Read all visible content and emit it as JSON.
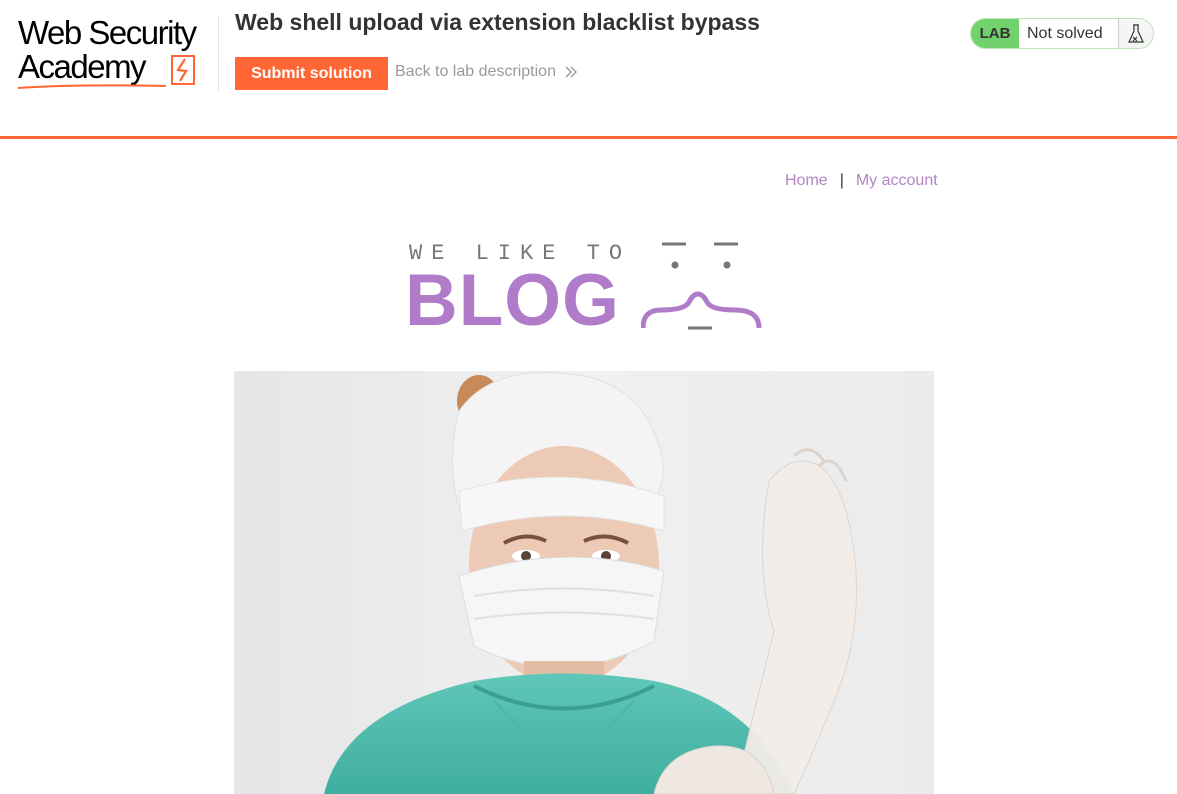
{
  "header": {
    "logo_line1": "Web Security",
    "logo_line2": "Academy",
    "lab_title": "Web shell upload via extension blacklist bypass",
    "submit_label": "Submit solution",
    "back_label": "Back to lab description",
    "back_icon": "double-chevron-right-icon",
    "lab_badge": "LAB",
    "lab_status": "Not solved",
    "status_icon": "flask-icon"
  },
  "nav": {
    "home": "Home",
    "separator": "|",
    "account": "My account"
  },
  "blog_logo": {
    "tagline": "WE LIKE TO",
    "wordmark": "BLOG"
  },
  "colors": {
    "accent_orange": "#ff6633",
    "lab_green": "#70d16d",
    "link_purple": "#b383c4",
    "blog_purple": "#b07bc9"
  }
}
